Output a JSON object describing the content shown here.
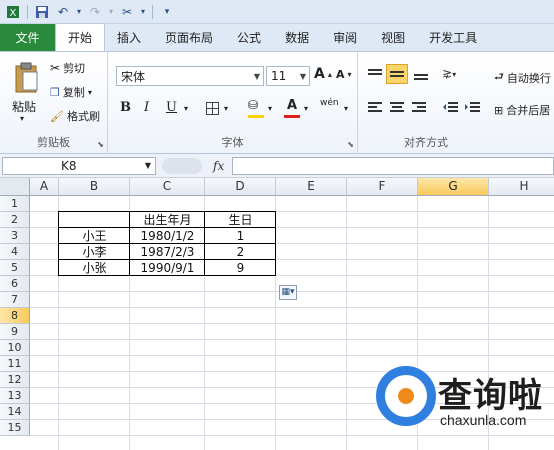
{
  "qat": {
    "icons": [
      "excel-icon",
      "save-icon",
      "undo-icon",
      "redo-icon",
      "customize-icon"
    ]
  },
  "tabs": [
    "文件",
    "开始",
    "插入",
    "页面布局",
    "公式",
    "数据",
    "审阅",
    "视图",
    "开发工具"
  ],
  "ribbon": {
    "clipboard": {
      "paste": "粘贴",
      "cut": "剪切",
      "copy": "复制",
      "format_painter": "格式刷",
      "label": "剪贴板"
    },
    "font": {
      "name": "宋体",
      "size": "11",
      "bold": "B",
      "italic": "I",
      "underline": "U",
      "grow": "A",
      "shrink": "A",
      "label": "字体",
      "wen": "wén",
      "font_color": "A"
    },
    "alignment": {
      "wrap": "自动换行",
      "merge": "合并后居",
      "label": "对齐方式"
    }
  },
  "formula_bar": {
    "name_box": "K8",
    "fx": "fx",
    "formula": ""
  },
  "columns": [
    "A",
    "B",
    "C",
    "D",
    "E",
    "F",
    "G",
    "H"
  ],
  "selected_column": "G",
  "rows": [
    "1",
    "2",
    "3",
    "4",
    "5",
    "6",
    "7",
    "8",
    "9",
    "10",
    "11",
    "12",
    "13",
    "14",
    "15"
  ],
  "selected_row": "8",
  "table": {
    "header": [
      "",
      "出生年月",
      "生日"
    ],
    "rows": [
      [
        "小王",
        "1980/1/2",
        "1"
      ],
      [
        "小李",
        "1987/2/3",
        "2"
      ],
      [
        "小张",
        "1990/9/1",
        "9"
      ]
    ]
  },
  "watermark": {
    "name": "查询啦",
    "url": "chaxunla.com"
  }
}
